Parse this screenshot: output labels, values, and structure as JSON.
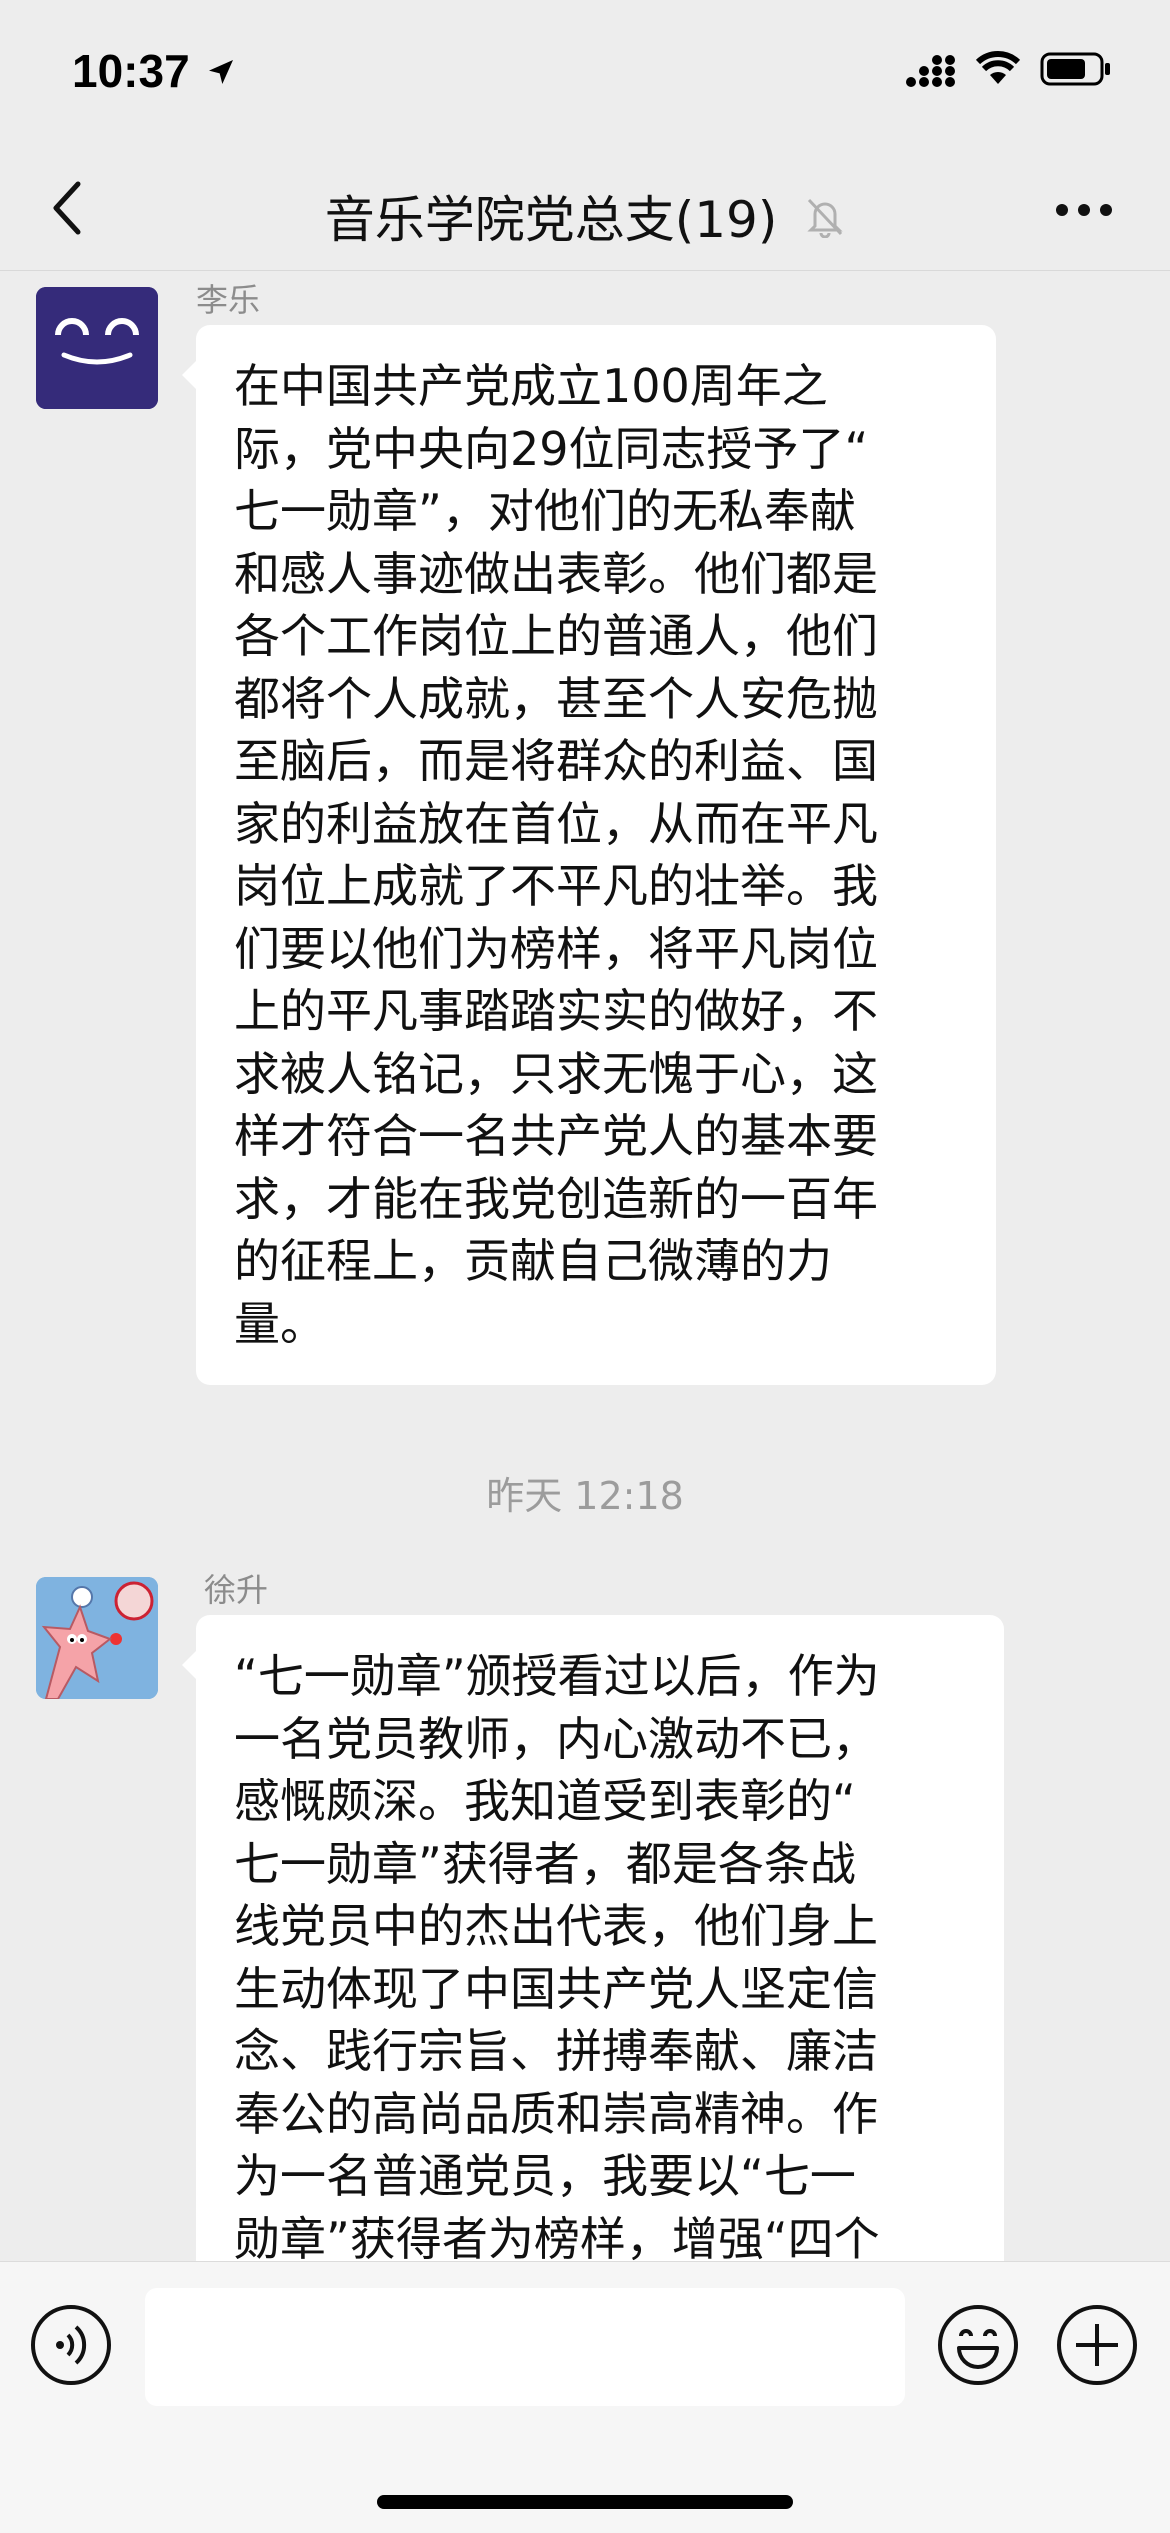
{
  "status_bar": {
    "time": "10:37"
  },
  "header": {
    "title": "音乐学院党总支(19)"
  },
  "messages": [
    {
      "sender": "李乐",
      "avatar_icon": "smiley-face-avatar",
      "lines": [
        "在中国共产党成立100周年之",
        "际，党中央向29位同志授予了“",
        "七一勋章”，对他们的无私奉献",
        "和感人事迹做出表彰。他们都是",
        "各个工作岗位上的普通人，他们",
        "都将个人成就，甚至个人安危抛",
        "至脑后，而是将群众的利益、国",
        "家的利益放在首位，从而在平凡",
        "岗位上成就了不平凡的壮举。我",
        "们要以他们为榜样，将平凡岗位",
        "上的平凡事踏踏实实的做好，不",
        "求被人铭记，只求无愧于心，这",
        "样才符合一名共产党人的基本要",
        "求，才能在我党创造新的一百年",
        "的征程上，贡献自己微薄的力",
        "量。"
      ]
    },
    {
      "sender": "徐升",
      "avatar_icon": "cartoon-starfish-avatar",
      "lines": [
        "“七一勋章”颁授看过以后，作为",
        "一名党员教师，内心激动不已，",
        "感慨颇深。我知道受到表彰的“",
        "七一勋章”获得者，都是各条战",
        "线党员中的杰出代表，他们身上",
        "生动体现了中国共产党人坚定信",
        "念、践行宗旨、拼搏奉献、廉洁",
        "奉公的高尚品质和崇高精神。作",
        "为一名普通党员，我要以“七一",
        "勋章”获得者为榜样，增强“四个"
      ]
    }
  ],
  "timestamp": "昨天 12:18",
  "input": {
    "value": ""
  }
}
